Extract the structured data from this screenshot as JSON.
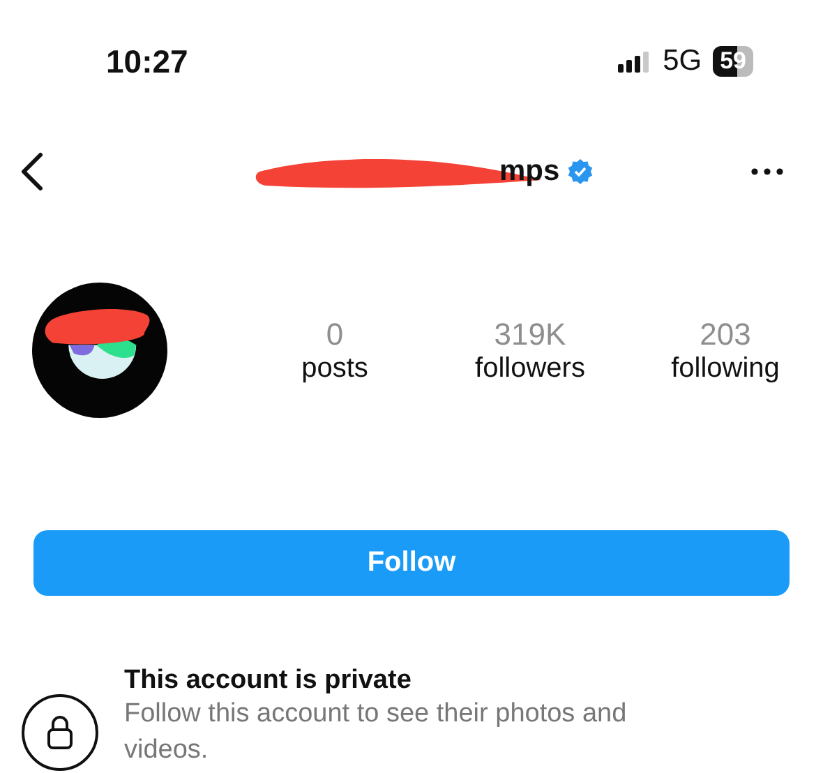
{
  "status_bar": {
    "time": "10:27",
    "network": "5G",
    "battery": "59"
  },
  "header": {
    "username": "mps",
    "verified": true
  },
  "stats": [
    {
      "value": "0",
      "label": "posts"
    },
    {
      "value": "319K",
      "label": "followers"
    },
    {
      "value": "203",
      "label": "following"
    }
  ],
  "follow_button": {
    "label": "Follow"
  },
  "private_notice": {
    "title": "This account is private",
    "text": "Follow this account to see their photos and videos."
  }
}
